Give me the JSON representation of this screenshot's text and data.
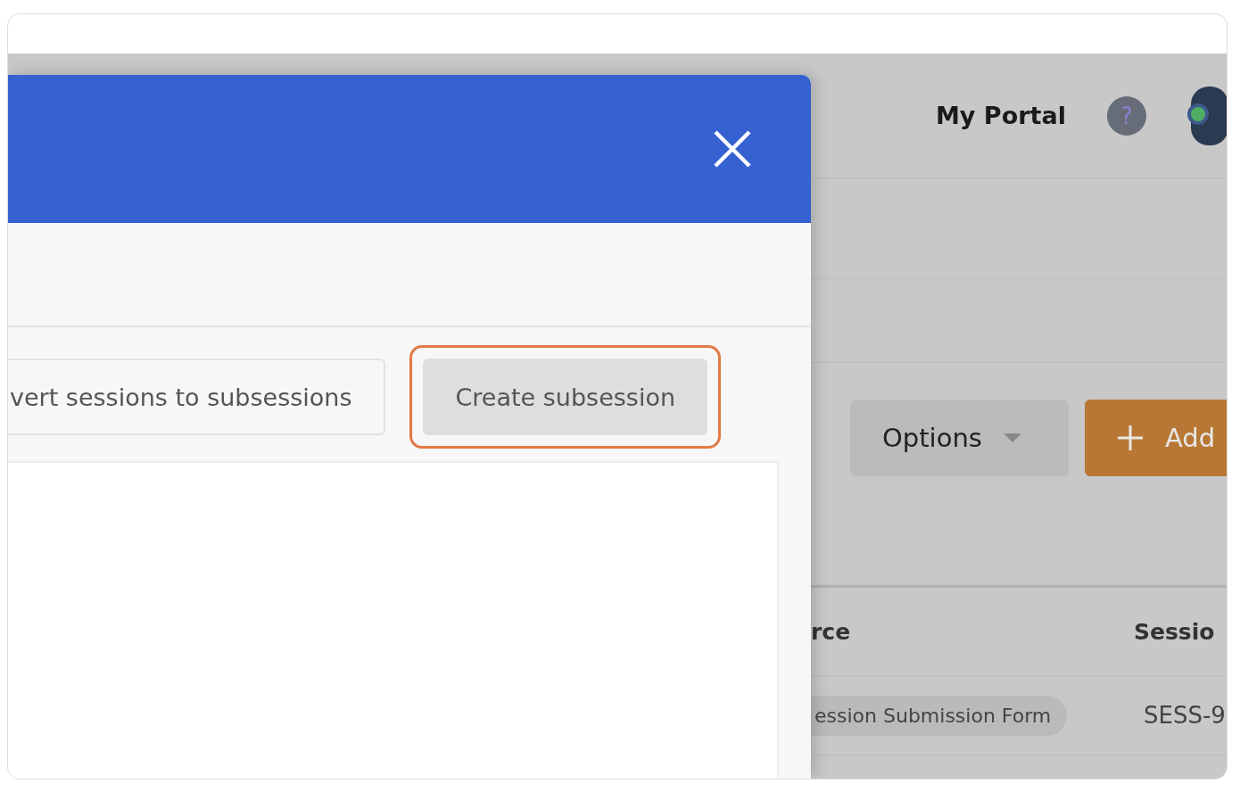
{
  "header": {
    "title": "My Portal",
    "help": "?"
  },
  "toolbar": {
    "buttons": [
      {
        "kind": "dropdown",
        "label": "Options"
      },
      {
        "kind": "primary",
        "label": "Add"
      }
    ]
  },
  "table": {
    "columns": [
      "rce",
      "Sessio"
    ],
    "rows": [
      [
        "ession Submission Form",
        "SESS-9"
      ]
    ]
  },
  "dialog": {
    "actions": [
      {
        "label": "vert sessions to subsessions",
        "highlighted": false
      },
      {
        "label": "Create subsession",
        "highlighted": true
      }
    ]
  }
}
